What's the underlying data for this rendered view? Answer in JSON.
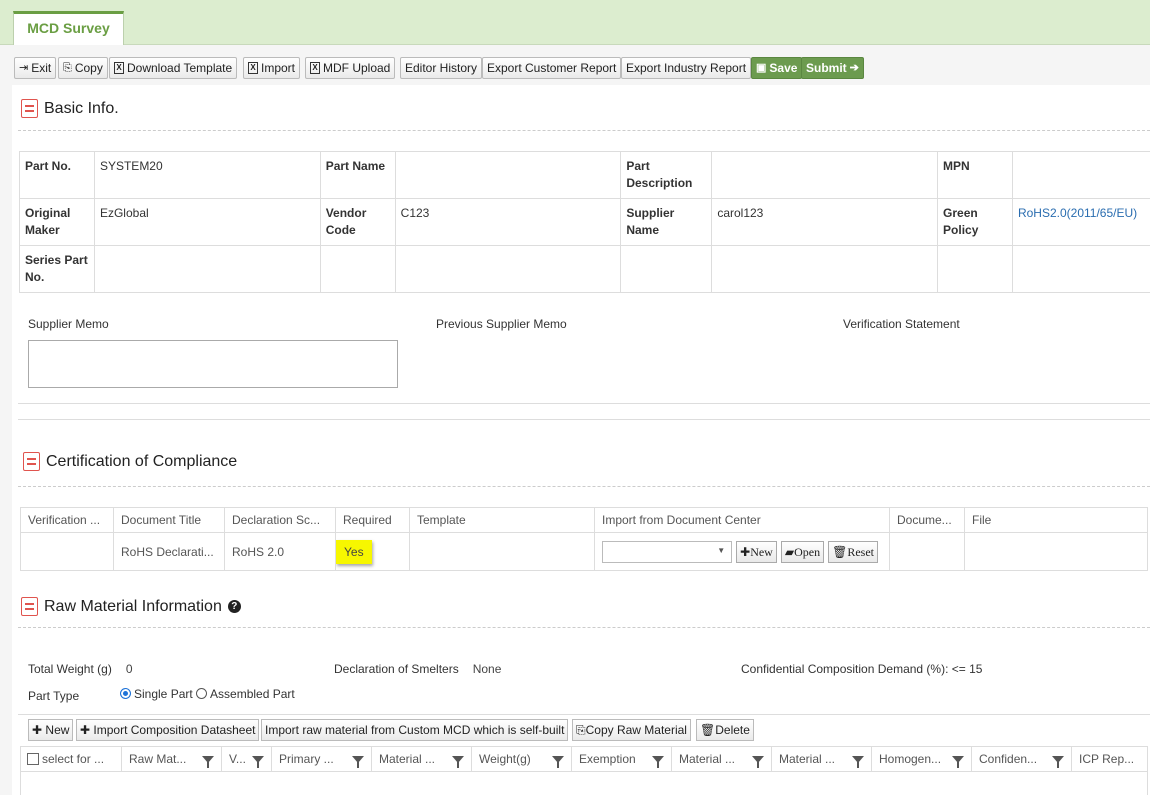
{
  "tab": {
    "label": "MCD Survey"
  },
  "toolbar": {
    "exit": "Exit",
    "copy": "Copy",
    "download_template": "Download Template",
    "import": "Import",
    "mdf_upload": "MDF Upload",
    "editor_history": "Editor History",
    "export_customer": "Export Customer Report",
    "export_industry": "Export Industry Report",
    "save": "Save",
    "submit": "Submit"
  },
  "basic_info": {
    "title": "Basic Info.",
    "part_no_label": "Part No.",
    "part_no": "SYSTEM20",
    "part_name_label": "Part Name",
    "part_name": "",
    "part_desc_label": "Part Description",
    "part_desc": "",
    "mpn_label": "MPN",
    "mpn": "",
    "orig_maker_label": "Original Maker",
    "orig_maker": "EzGlobal",
    "vendor_code_label": "Vendor Code",
    "vendor_code": "C123",
    "supplier_name_label": "Supplier Name",
    "supplier_name": "carol123",
    "green_policy_label": "Green Policy",
    "green_policy": "RoHS2.0(2011/65/EU)",
    "series_part_label": "Series Part No.",
    "series_part": "",
    "supplier_memo_label": "Supplier Memo",
    "previous_memo_label": "Previous Supplier Memo",
    "verification_label": "Verification Statement",
    "supplier_memo_value": ""
  },
  "coc": {
    "title": "Certification of Compliance",
    "headers": [
      "Verification ...",
      "Document Title",
      "Declaration Sc...",
      "Required",
      "Template",
      "Import from Document Center",
      "Docume...",
      "File"
    ],
    "row": {
      "verification": "",
      "document_title": "RoHS Declarati...",
      "declaration_scope": "RoHS 2.0",
      "required": "Yes",
      "template": "",
      "import_select": "",
      "document": "",
      "file": ""
    },
    "new_btn": "New",
    "open_btn": "Open",
    "reset_btn": "Reset"
  },
  "raw_material": {
    "title": "Raw Material Information",
    "total_weight_label": "Total Weight (g)",
    "total_weight": "0",
    "smelters_label": "Declaration of Smelters",
    "smelters": "None",
    "confidential_label": "Confidential Composition Demand (%):",
    "confidential": "<= 15",
    "part_type_label": "Part Type",
    "single_part": "Single Part",
    "assembled_part": "Assembled Part",
    "new_btn": "New",
    "import_composition": "Import Composition Datasheet",
    "import_custom": "Import raw material from Custom MCD which is self-built",
    "copy_raw": "Copy Raw Material",
    "delete": "Delete",
    "columns": [
      "select for ...",
      "Raw Mat...",
      "V...",
      "Primary ...",
      "Material ...",
      "Weight(g)",
      "Exemption",
      "Material ...",
      "Material ...",
      "Homogen...",
      "Confiden...",
      "ICP Rep..."
    ]
  }
}
